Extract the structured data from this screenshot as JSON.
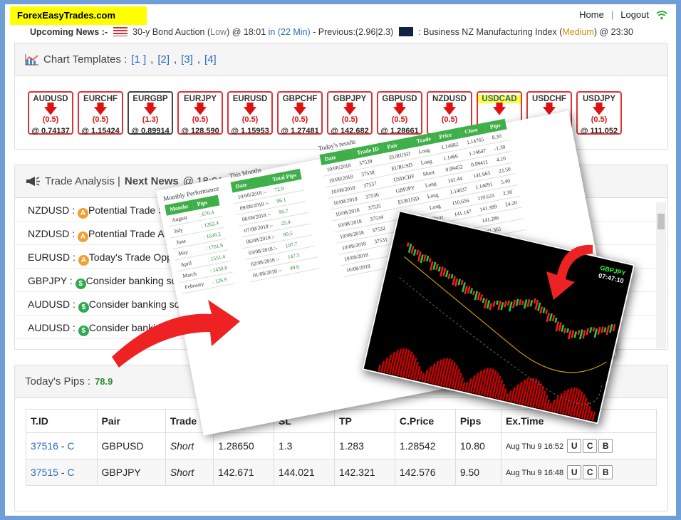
{
  "brand": "ForexEasyTrades.com",
  "nav": {
    "home": "Home",
    "sep": "|",
    "logout": "Logout"
  },
  "news": {
    "label": "Upcoming News :-",
    "item1": "30-y Bond Auction",
    "item1_impact": "Low",
    "item1_time": "@ 18:01",
    "item1_in": "in (22 Min)",
    "item1_prev": "-  Previous:(2.96|2.3)",
    "item2": ": Business NZ Manufacturing Index",
    "item2_impact": "Medium",
    "item2_time": "@ 23:30"
  },
  "templates": {
    "title": "Chart Templates :",
    "l1": "[1 ]",
    "l2": "[2]",
    "l3": "[3]",
    "l4": "[4]"
  },
  "pairs": [
    {
      "name": "AUDUSD",
      "chg": "(0.5)",
      "price": "@ 0.74137"
    },
    {
      "name": "EURCHF",
      "chg": "(0.5)",
      "price": "@ 1.15424"
    },
    {
      "name": "EURGBP",
      "chg": "(1.3)",
      "price": "@ 0.89914"
    },
    {
      "name": "EURJPY",
      "chg": "(0.5)",
      "price": "@ 128.590"
    },
    {
      "name": "EURUSD",
      "chg": "(0.5)",
      "price": "@ 1.15953"
    },
    {
      "name": "GBPCHF",
      "chg": "(0.5)",
      "price": "@ 1.27481"
    },
    {
      "name": "GBPJPY",
      "chg": "(0.5)",
      "price": "@ 142.682"
    },
    {
      "name": "GBPUSD",
      "chg": "(0.5)",
      "price": "@ 1.28661"
    },
    {
      "name": "NZDUSD",
      "chg": "(0.5)",
      "price": ""
    },
    {
      "name": "USDCAD",
      "chg": "",
      "price": ""
    },
    {
      "name": "USDCHF",
      "chg": "",
      "price": ""
    },
    {
      "name": "USDJPY",
      "chg": "(0.5)",
      "price": "@ 111.052"
    }
  ],
  "analysis": {
    "title": "Trade Analysis |",
    "next": "Next News",
    "time": "@ 18:01"
  },
  "alerts": [
    {
      "pair": "NZDUSD :",
      "text": "Potential Trade Se"
    },
    {
      "pair": "NZDUSD :",
      "text": "Potential Trade Aler"
    },
    {
      "pair": "EURUSD :",
      "text": "Today's Trade Oppor"
    },
    {
      "pair": "GBPJPY :",
      "text": "Consider banking some"
    },
    {
      "pair": "AUDUSD :",
      "text": "Consider banking some"
    },
    {
      "pair": "AUDUSD :",
      "text": "Consider banking som"
    }
  ],
  "pips": {
    "title": "Today's Pips :",
    "value": "78.9"
  },
  "trades": {
    "headers": [
      "T.ID",
      "Pair",
      "Trade",
      "",
      "SL",
      "TP",
      "C.Price",
      "Pips",
      "Ex.Time"
    ],
    "rows": [
      {
        "id": "37516",
        "c": "C",
        "pair": "GBPUSD",
        "trade": "Short",
        "open": "1.28650",
        "sl": "1.3",
        "tp": "1.283",
        "cp": "1.28542",
        "pips": "10.80",
        "time": "Aug Thu 9 16:52"
      },
      {
        "id": "37515",
        "c": "C",
        "pair": "GBPJPY",
        "trade": "Short",
        "open": "142.671",
        "sl": "144.021",
        "tp": "142.321",
        "cp": "142.576",
        "pips": "9.50",
        "time": "Aug Thu 9 16:48"
      }
    ],
    "btn_u": "U",
    "btn_c": "C",
    "btn_b": "B"
  },
  "overlay": {
    "monthly_cap": "Monthly Performance",
    "monthly_h": [
      "Months",
      "Pips"
    ],
    "monthly": [
      [
        "August",
        ": 670.4"
      ],
      [
        "July",
        ": 1262.4"
      ],
      [
        "June",
        ": 1638.2"
      ],
      [
        "May",
        ": 1701.8"
      ],
      [
        "April",
        ": 1551.4"
      ],
      [
        "March",
        ": 1430.8"
      ],
      [
        "February",
        ": 126.9"
      ]
    ],
    "this_cap": "This Months",
    "this_h": [
      "Date",
      "Total Pips"
    ],
    "this": [
      [
        "10/08/2018 :-",
        "72.9"
      ],
      [
        "09/08/2018 :-",
        "96.1"
      ],
      [
        "08/08/2018 :-",
        "90.7"
      ],
      [
        "07/08/2018 :-",
        "25.4"
      ],
      [
        "06/08/2018 :-",
        "80.5"
      ],
      [
        "03/08/2018 :-",
        "107.7"
      ],
      [
        "02/08/2018 :-",
        "147.5"
      ],
      [
        "01/08/2018 :-",
        "49.6"
      ]
    ],
    "today_cap": "Today's results",
    "today_h": [
      "Date",
      "Trade ID",
      "Pair",
      "Trade",
      "Price",
      "Close",
      "Pips"
    ],
    "today": [
      [
        "10/08/2018",
        "37539",
        "EURUSD",
        "Long",
        "1.14682",
        "1.14765",
        "8.30"
      ],
      [
        "10/08/2018",
        "37538",
        "EURUSD",
        "Long",
        "1.1466",
        "1.14647",
        "-1.30"
      ],
      [
        "10/08/2018",
        "37537",
        "USDCHF",
        "Short",
        "0.99452",
        "0.99411",
        "4.10"
      ],
      [
        "10/08/2018",
        "37536",
        "GBPJPY",
        "Long",
        "141.44",
        "141.665",
        "22.50"
      ],
      [
        "10/08/2018",
        "37535",
        "EURUSD",
        "Long",
        "1.14637",
        "1.14691",
        "5.40"
      ],
      [
        "10/08/2018",
        "37534",
        "",
        "Long",
        "110.656",
        "110.633",
        "2.30"
      ],
      [
        "10/08/2018",
        "37532",
        "",
        "Short",
        "141.147",
        "141.389",
        "24.20"
      ],
      [
        "10/08/2018",
        "37531",
        "",
        "",
        "",
        "141.286",
        ""
      ],
      [
        "10/08/2018",
        "",
        "",
        "",
        "",
        "141.365",
        ""
      ],
      [
        "10/08/2018",
        "",
        "",
        "",
        "",
        "",
        ""
      ]
    ],
    "chart_sym": "GBPJPY",
    "chart_time": "07:47:10"
  }
}
